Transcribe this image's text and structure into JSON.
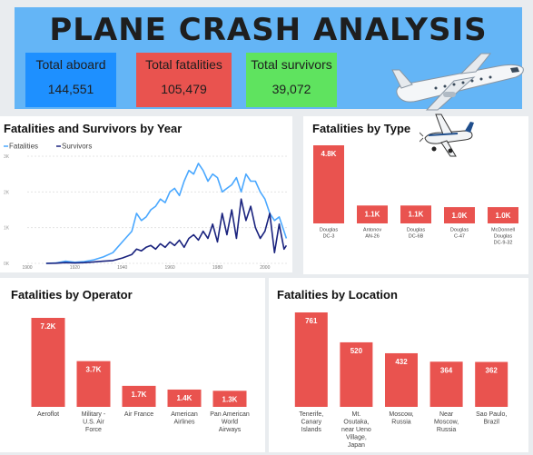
{
  "title": "PLANE CRASH ANALYSIS",
  "kpis": {
    "aboard": {
      "label": "Total aboard",
      "value": "144,551"
    },
    "fatalities": {
      "label": "Total fatalities",
      "value": "105,479"
    },
    "survivors": {
      "label": "Total survivors",
      "value": "39,072"
    }
  },
  "colors": {
    "banner": "#64b5f6",
    "aboard": "#1e90ff",
    "fatalities_card": "#e9534f",
    "survivors_card": "#5fe35f",
    "bar": "#e9534f",
    "line_fatalities": "#4aa8ff",
    "line_survivors": "#1a237e"
  },
  "icons": [
    "airplane-icon",
    "small-airplane-icon"
  ],
  "panels": {
    "year": "Fatalities and Survivors by Year",
    "type": "Fatalities by Type",
    "operator": "Fatalities by Operator",
    "location": "Fatalities by Location"
  },
  "chart_data": [
    {
      "type": "line",
      "title": "Fatalities and Survivors by Year",
      "xlim": [
        1908,
        2009
      ],
      "ylim": [
        0,
        3000
      ],
      "yticks": [
        "0K",
        "1K",
        "2K",
        "3K"
      ],
      "xticks": [
        1900,
        1920,
        1940,
        1960,
        1980,
        2000
      ],
      "legend": "top-left",
      "series": [
        {
          "name": "Fatalities",
          "x": [
            1908,
            1912,
            1916,
            1920,
            1924,
            1928,
            1932,
            1936,
            1940,
            1944,
            1946,
            1948,
            1950,
            1952,
            1954,
            1956,
            1958,
            1960,
            1962,
            1964,
            1966,
            1968,
            1970,
            1972,
            1974,
            1976,
            1978,
            1980,
            1982,
            1984,
            1986,
            1988,
            1990,
            1992,
            1994,
            1996,
            1998,
            2000,
            2002,
            2004,
            2006,
            2008,
            2009
          ],
          "y": [
            1,
            10,
            60,
            30,
            50,
            100,
            180,
            300,
            600,
            900,
            1400,
            1200,
            1300,
            1500,
            1600,
            1800,
            1700,
            2000,
            2100,
            1900,
            2300,
            2600,
            2500,
            2800,
            2600,
            2300,
            2500,
            2400,
            2000,
            2100,
            2200,
            2400,
            2000,
            2500,
            2300,
            2300,
            2000,
            1800,
            1400,
            1200,
            1300,
            900,
            700
          ]
        },
        {
          "name": "Survivors",
          "x": [
            1908,
            1912,
            1916,
            1920,
            1924,
            1928,
            1932,
            1936,
            1940,
            1944,
            1946,
            1948,
            1950,
            1952,
            1954,
            1956,
            1958,
            1960,
            1962,
            1964,
            1966,
            1968,
            1970,
            1972,
            1974,
            1976,
            1978,
            1980,
            1982,
            1984,
            1986,
            1988,
            1990,
            1992,
            1994,
            1996,
            1998,
            2000,
            2002,
            2004,
            2006,
            2008,
            2009
          ],
          "y": [
            0,
            5,
            20,
            10,
            20,
            40,
            60,
            80,
            150,
            250,
            400,
            350,
            450,
            500,
            400,
            550,
            450,
            600,
            500,
            650,
            450,
            700,
            800,
            650,
            900,
            700,
            1100,
            600,
            1400,
            800,
            1500,
            700,
            1800,
            1200,
            1600,
            1000,
            700,
            900,
            1400,
            300,
            1100,
            400,
            500
          ]
        }
      ]
    },
    {
      "type": "bar",
      "title": "Fatalities by Type",
      "categories": [
        "Douglas DC-3",
        "Antonov AN-26",
        "Douglas DC-6B",
        "Douglas C-47",
        "McDonnell Douglas DC-9-32"
      ],
      "values": [
        4800,
        1100,
        1100,
        1000,
        1000
      ],
      "labels": [
        "4.8K",
        "1.1K",
        "1.1K",
        "1.0K",
        "1.0K"
      ]
    },
    {
      "type": "bar",
      "title": "Fatalities by Operator",
      "categories": [
        "Aeroflot",
        "Military - U.S. Air Force",
        "Air France",
        "American Airlines",
        "Pan American World Airways"
      ],
      "values": [
        7200,
        3700,
        1700,
        1400,
        1300
      ],
      "labels": [
        "7.2K",
        "3.7K",
        "1.7K",
        "1.4K",
        "1.3K"
      ]
    },
    {
      "type": "bar",
      "title": "Fatalities by Location",
      "categories": [
        "Tenerife, Canary Islands",
        "Mt. Osutaka, near Ueno Village, Japan",
        "Moscow, Russia",
        "Near Moscow, Russia",
        "Sao Paulo, Brazil"
      ],
      "values": [
        761,
        520,
        432,
        364,
        362
      ],
      "labels": [
        "761",
        "520",
        "432",
        "364",
        "362"
      ]
    }
  ]
}
